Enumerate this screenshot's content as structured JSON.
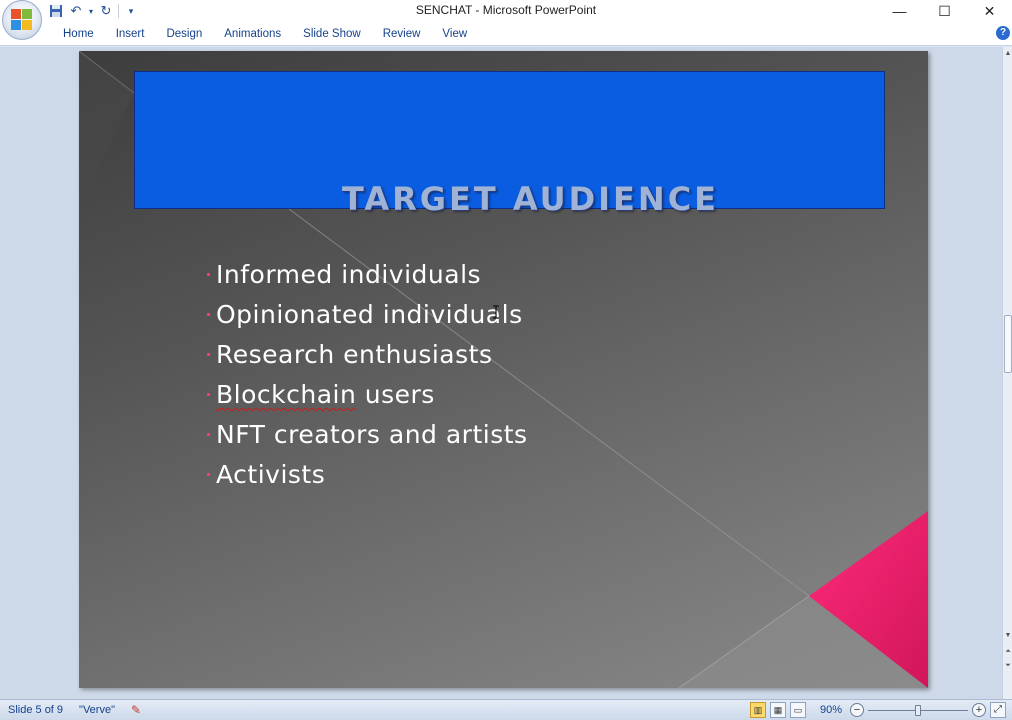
{
  "window": {
    "title": "SENCHAT - Microsoft PowerPoint",
    "minimize": "—",
    "maximize": "☐",
    "close": "✕"
  },
  "quick_access": {
    "save_icon": "save-icon",
    "undo_icon": "undo-icon",
    "redo_icon": "redo-icon",
    "customize_icon": "customize-icon"
  },
  "ribbon": {
    "tabs": [
      {
        "label": "Home"
      },
      {
        "label": "Insert"
      },
      {
        "label": "Design"
      },
      {
        "label": "Animations"
      },
      {
        "label": "Slide Show"
      },
      {
        "label": "Review"
      },
      {
        "label": "View"
      }
    ],
    "help": "?"
  },
  "slide": {
    "title": "TARGET AUDIENCE",
    "bullets": [
      {
        "text": "Informed individuals"
      },
      {
        "text": "Opinionated individuals"
      },
      {
        "text": "Research enthusiasts"
      },
      {
        "text_a": "Blockchain",
        "text_b": " users"
      },
      {
        "text": "NFT creators and artists"
      },
      {
        "text": "Activists"
      }
    ],
    "colors": {
      "title_bg": "#0a5ce0",
      "accent": "#ff1f6f"
    }
  },
  "statusbar": {
    "slide_info": "Slide 5 of 9",
    "theme": "\"Verve\"",
    "zoom": "90%",
    "zoom_level": 0.5
  }
}
